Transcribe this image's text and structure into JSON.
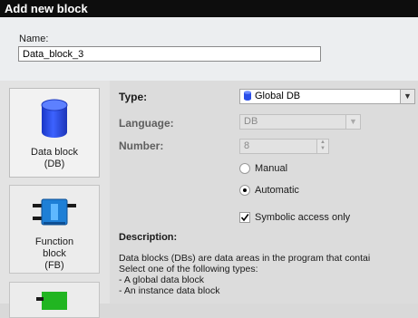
{
  "dialog": {
    "title": "Add new block"
  },
  "name_field": {
    "label": "Name:",
    "value": "Data_block_3"
  },
  "block_types": [
    {
      "label_line1": "Data block",
      "label_line2": "(DB)",
      "icon": "database-icon",
      "selected": true
    },
    {
      "label_line1": "Function",
      "label_line2": "block",
      "label_line3": "(FB)",
      "icon": "function-block-icon",
      "selected": false
    },
    {
      "label_line1": "",
      "icon": "function-icon",
      "selected": false
    }
  ],
  "fields": {
    "type": {
      "label": "Type:",
      "value": "Global DB"
    },
    "language": {
      "label": "Language:",
      "value": "DB"
    },
    "number": {
      "label": "Number:",
      "value": "8"
    }
  },
  "numbering": {
    "manual_label": "Manual",
    "automatic_label": "Automatic",
    "selected": "Automatic"
  },
  "symbolic_access": {
    "label": "Symbolic access only",
    "checked": true
  },
  "description": {
    "heading": "Description:",
    "lines": [
      "Data blocks (DBs) are data areas in the program that contai",
      "Select one of the following types:",
      "- A global data block",
      "- An instance data block"
    ]
  },
  "colors": {
    "title_bar": "#0d0d0d",
    "db_icon_blue": "#2a4ee8",
    "fb_icon_blue": "#1e7fd6",
    "fc_icon_green": "#21b521"
  }
}
